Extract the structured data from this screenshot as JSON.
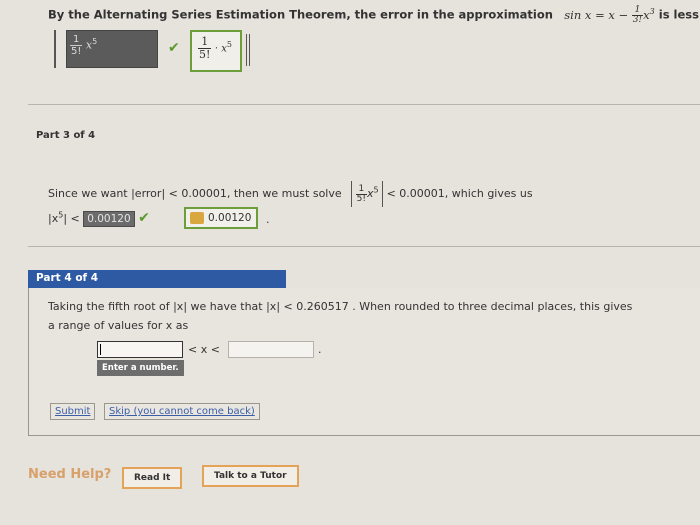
{
  "part2": {
    "text": "By the Alternating Series Estimation Theorem, the error in the approximation",
    "formula_lhs": "sin x = x −",
    "frac_num": "1",
    "frac_den": "3!",
    "formula_tail": "x",
    "formula_exp": "3",
    "text_end": "is less than",
    "answer_num": "1",
    "answer_den": "5!",
    "answer_x": "x",
    "answer_exp": "5",
    "correct_num": "1",
    "correct_den": "5!",
    "correct_x": "· x",
    "correct_exp": "5"
  },
  "part3": {
    "heading": "Part 3 of 4",
    "text_start": "Since we want |error| < 0.00001, then we must solve",
    "frac_num": "1",
    "frac_den": "5!",
    "x": "x",
    "exp": "5",
    "text_end": "< 0.00001,  which gives us",
    "lhs": "|x",
    "lhs_exp": "5",
    "lhs_tail": "| <",
    "answer": "0.00120",
    "correct": "0.00120",
    "period": "."
  },
  "part4": {
    "heading": "Part 4 of 4",
    "line1": "Taking the fifth root of  |x|  we have that  |x| < 0.260517 .  When rounded to three decimal places, this gives",
    "line2": "a range of values for x as",
    "ineq": "< x <",
    "period": ".",
    "tooltip": "Enter a number.",
    "submit": "Submit",
    "skip": "Skip (you cannot come back)"
  },
  "help": {
    "label": "Need Help?",
    "read_it": "Read It",
    "tutor": "Talk to a Tutor"
  }
}
